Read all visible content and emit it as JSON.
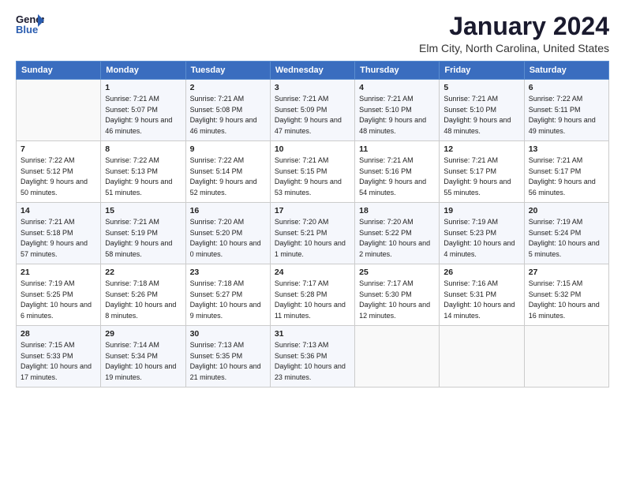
{
  "logo": {
    "line1": "General",
    "line2": "Blue"
  },
  "title": "January 2024",
  "subtitle": "Elm City, North Carolina, United States",
  "headers": [
    "Sunday",
    "Monday",
    "Tuesday",
    "Wednesday",
    "Thursday",
    "Friday",
    "Saturday"
  ],
  "weeks": [
    [
      {
        "day": "",
        "sunrise": "",
        "sunset": "",
        "daylight": ""
      },
      {
        "day": "1",
        "sunrise": "Sunrise: 7:21 AM",
        "sunset": "Sunset: 5:07 PM",
        "daylight": "Daylight: 9 hours and 46 minutes."
      },
      {
        "day": "2",
        "sunrise": "Sunrise: 7:21 AM",
        "sunset": "Sunset: 5:08 PM",
        "daylight": "Daylight: 9 hours and 46 minutes."
      },
      {
        "day": "3",
        "sunrise": "Sunrise: 7:21 AM",
        "sunset": "Sunset: 5:09 PM",
        "daylight": "Daylight: 9 hours and 47 minutes."
      },
      {
        "day": "4",
        "sunrise": "Sunrise: 7:21 AM",
        "sunset": "Sunset: 5:10 PM",
        "daylight": "Daylight: 9 hours and 48 minutes."
      },
      {
        "day": "5",
        "sunrise": "Sunrise: 7:21 AM",
        "sunset": "Sunset: 5:10 PM",
        "daylight": "Daylight: 9 hours and 48 minutes."
      },
      {
        "day": "6",
        "sunrise": "Sunrise: 7:22 AM",
        "sunset": "Sunset: 5:11 PM",
        "daylight": "Daylight: 9 hours and 49 minutes."
      }
    ],
    [
      {
        "day": "7",
        "sunrise": "Sunrise: 7:22 AM",
        "sunset": "Sunset: 5:12 PM",
        "daylight": "Daylight: 9 hours and 50 minutes."
      },
      {
        "day": "8",
        "sunrise": "Sunrise: 7:22 AM",
        "sunset": "Sunset: 5:13 PM",
        "daylight": "Daylight: 9 hours and 51 minutes."
      },
      {
        "day": "9",
        "sunrise": "Sunrise: 7:22 AM",
        "sunset": "Sunset: 5:14 PM",
        "daylight": "Daylight: 9 hours and 52 minutes."
      },
      {
        "day": "10",
        "sunrise": "Sunrise: 7:21 AM",
        "sunset": "Sunset: 5:15 PM",
        "daylight": "Daylight: 9 hours and 53 minutes."
      },
      {
        "day": "11",
        "sunrise": "Sunrise: 7:21 AM",
        "sunset": "Sunset: 5:16 PM",
        "daylight": "Daylight: 9 hours and 54 minutes."
      },
      {
        "day": "12",
        "sunrise": "Sunrise: 7:21 AM",
        "sunset": "Sunset: 5:17 PM",
        "daylight": "Daylight: 9 hours and 55 minutes."
      },
      {
        "day": "13",
        "sunrise": "Sunrise: 7:21 AM",
        "sunset": "Sunset: 5:17 PM",
        "daylight": "Daylight: 9 hours and 56 minutes."
      }
    ],
    [
      {
        "day": "14",
        "sunrise": "Sunrise: 7:21 AM",
        "sunset": "Sunset: 5:18 PM",
        "daylight": "Daylight: 9 hours and 57 minutes."
      },
      {
        "day": "15",
        "sunrise": "Sunrise: 7:21 AM",
        "sunset": "Sunset: 5:19 PM",
        "daylight": "Daylight: 9 hours and 58 minutes."
      },
      {
        "day": "16",
        "sunrise": "Sunrise: 7:20 AM",
        "sunset": "Sunset: 5:20 PM",
        "daylight": "Daylight: 10 hours and 0 minutes."
      },
      {
        "day": "17",
        "sunrise": "Sunrise: 7:20 AM",
        "sunset": "Sunset: 5:21 PM",
        "daylight": "Daylight: 10 hours and 1 minute."
      },
      {
        "day": "18",
        "sunrise": "Sunrise: 7:20 AM",
        "sunset": "Sunset: 5:22 PM",
        "daylight": "Daylight: 10 hours and 2 minutes."
      },
      {
        "day": "19",
        "sunrise": "Sunrise: 7:19 AM",
        "sunset": "Sunset: 5:23 PM",
        "daylight": "Daylight: 10 hours and 4 minutes."
      },
      {
        "day": "20",
        "sunrise": "Sunrise: 7:19 AM",
        "sunset": "Sunset: 5:24 PM",
        "daylight": "Daylight: 10 hours and 5 minutes."
      }
    ],
    [
      {
        "day": "21",
        "sunrise": "Sunrise: 7:19 AM",
        "sunset": "Sunset: 5:25 PM",
        "daylight": "Daylight: 10 hours and 6 minutes."
      },
      {
        "day": "22",
        "sunrise": "Sunrise: 7:18 AM",
        "sunset": "Sunset: 5:26 PM",
        "daylight": "Daylight: 10 hours and 8 minutes."
      },
      {
        "day": "23",
        "sunrise": "Sunrise: 7:18 AM",
        "sunset": "Sunset: 5:27 PM",
        "daylight": "Daylight: 10 hours and 9 minutes."
      },
      {
        "day": "24",
        "sunrise": "Sunrise: 7:17 AM",
        "sunset": "Sunset: 5:28 PM",
        "daylight": "Daylight: 10 hours and 11 minutes."
      },
      {
        "day": "25",
        "sunrise": "Sunrise: 7:17 AM",
        "sunset": "Sunset: 5:30 PM",
        "daylight": "Daylight: 10 hours and 12 minutes."
      },
      {
        "day": "26",
        "sunrise": "Sunrise: 7:16 AM",
        "sunset": "Sunset: 5:31 PM",
        "daylight": "Daylight: 10 hours and 14 minutes."
      },
      {
        "day": "27",
        "sunrise": "Sunrise: 7:15 AM",
        "sunset": "Sunset: 5:32 PM",
        "daylight": "Daylight: 10 hours and 16 minutes."
      }
    ],
    [
      {
        "day": "28",
        "sunrise": "Sunrise: 7:15 AM",
        "sunset": "Sunset: 5:33 PM",
        "daylight": "Daylight: 10 hours and 17 minutes."
      },
      {
        "day": "29",
        "sunrise": "Sunrise: 7:14 AM",
        "sunset": "Sunset: 5:34 PM",
        "daylight": "Daylight: 10 hours and 19 minutes."
      },
      {
        "day": "30",
        "sunrise": "Sunrise: 7:13 AM",
        "sunset": "Sunset: 5:35 PM",
        "daylight": "Daylight: 10 hours and 21 minutes."
      },
      {
        "day": "31",
        "sunrise": "Sunrise: 7:13 AM",
        "sunset": "Sunset: 5:36 PM",
        "daylight": "Daylight: 10 hours and 23 minutes."
      },
      {
        "day": "",
        "sunrise": "",
        "sunset": "",
        "daylight": ""
      },
      {
        "day": "",
        "sunrise": "",
        "sunset": "",
        "daylight": ""
      },
      {
        "day": "",
        "sunrise": "",
        "sunset": "",
        "daylight": ""
      }
    ]
  ]
}
